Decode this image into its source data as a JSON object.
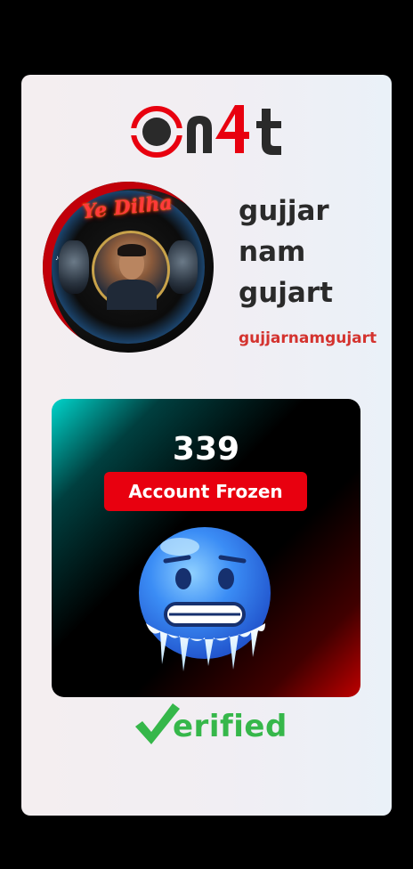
{
  "brand": {
    "logo_text": "on4t",
    "colors": {
      "red": "#e8000f",
      "dark": "#2a2a2a"
    }
  },
  "profile": {
    "display_name": "gujjar nam gujart",
    "display_name_lines": [
      "gujjar",
      "nam",
      "gujart"
    ],
    "username": "gujjarnamgujart",
    "avatar_title": "Ye Dilha"
  },
  "stats": {
    "count": "339",
    "status_label": "Account Frozen",
    "emoji": "freezing-face"
  },
  "verified": {
    "label": "erified"
  },
  "colors": {
    "accent_red": "#e8000f",
    "verified_green": "#36b74a",
    "username_red": "#d4332f"
  }
}
